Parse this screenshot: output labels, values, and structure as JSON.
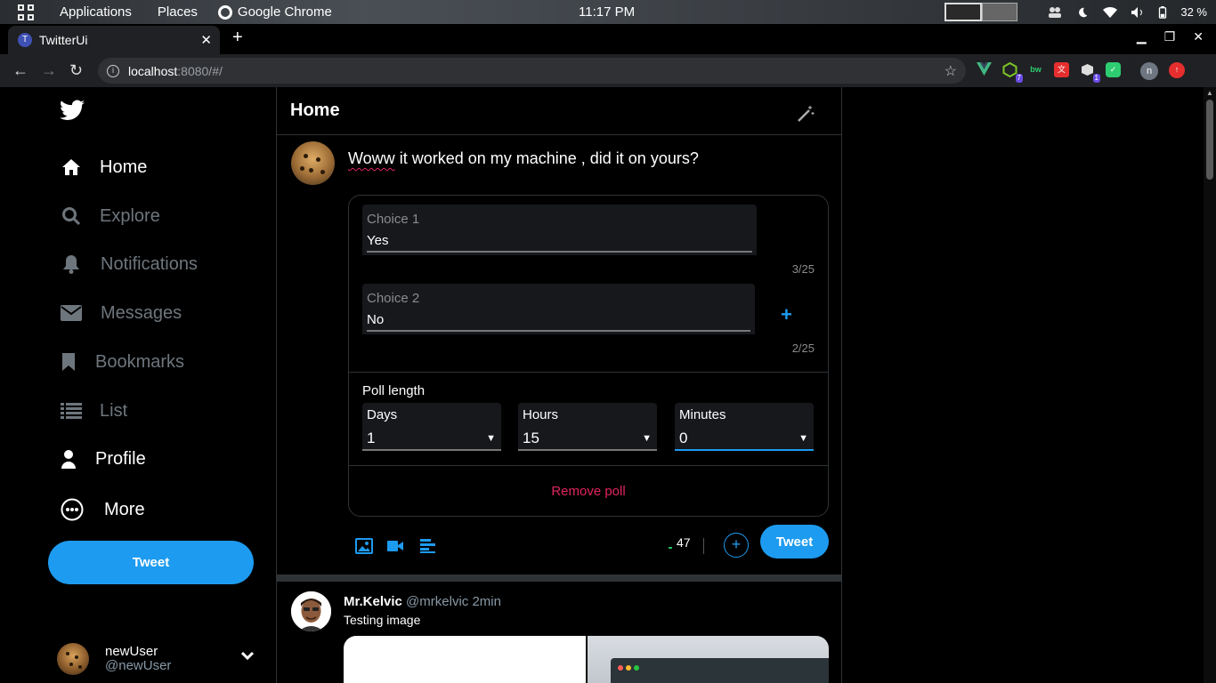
{
  "system_bar": {
    "applications": "Applications",
    "places": "Places",
    "browser": "Google Chrome",
    "clock": "11:17 PM",
    "battery": "32 %"
  },
  "browser": {
    "tab_title": "TwitterUi",
    "tab_favicon_letter": "T",
    "url_host": "localhost",
    "url_path": ":8080/#/",
    "profile_initial": "n",
    "extensions": [
      {
        "name": "vue-devtools-icon",
        "color": "#42b883",
        "label": ""
      },
      {
        "name": "node-icon",
        "color": "#1c1c1c",
        "badge": "7",
        "label": ""
      },
      {
        "name": "bw-icon",
        "color": "#1c1c1c",
        "label": "bw"
      },
      {
        "name": "translate-icon",
        "color": "#e62e2e",
        "label": ""
      },
      {
        "name": "box-icon",
        "color": "#1c1c1c",
        "badge": "1",
        "label": ""
      },
      {
        "name": "pocket-icon",
        "color": "#2ecc71",
        "label": ""
      }
    ]
  },
  "sidebar": {
    "items": [
      {
        "label": "Home",
        "icon": "home-icon",
        "active": true
      },
      {
        "label": "Explore",
        "icon": "search-icon",
        "active": false
      },
      {
        "label": "Notifications",
        "icon": "bell-icon",
        "active": false
      },
      {
        "label": "Messages",
        "icon": "mail-icon",
        "active": false
      },
      {
        "label": "Bookmarks",
        "icon": "bookmark-icon",
        "active": false
      },
      {
        "label": "List",
        "icon": "list-icon",
        "active": false
      },
      {
        "label": "Profile",
        "icon": "user-icon",
        "active": true
      },
      {
        "label": "More",
        "icon": "more-icon",
        "active": true
      }
    ],
    "tweet_button": "Tweet",
    "user": {
      "name": "newUser",
      "handle": "@newUser"
    }
  },
  "feed": {
    "title": "Home",
    "compose": {
      "text_misspelled": "Woww",
      "text_rest": " it worked on my machine , did it on yours?",
      "choices": [
        {
          "label": "Choice 1",
          "value": "Yes",
          "count": "3/25"
        },
        {
          "label": "Choice 2",
          "value": "No",
          "count": "2/25"
        }
      ],
      "add_choice": "+",
      "poll_length_label": "Poll length",
      "selects": [
        {
          "label": "Days",
          "value": "1"
        },
        {
          "label": "Hours",
          "value": "15"
        },
        {
          "label": "Minutes",
          "value": "0"
        }
      ],
      "remove_poll": "Remove poll",
      "char_count": "47",
      "add_button": "+",
      "tweet_button": "Tweet"
    },
    "post": {
      "name": "Mr.Kelvic",
      "handle": "@mrkelvic",
      "time": "2min",
      "text": "Testing image"
    }
  },
  "colors": {
    "accent": "#1d9bf0",
    "danger": "#e0245e",
    "background": "#000000",
    "border": "#2f3336"
  }
}
